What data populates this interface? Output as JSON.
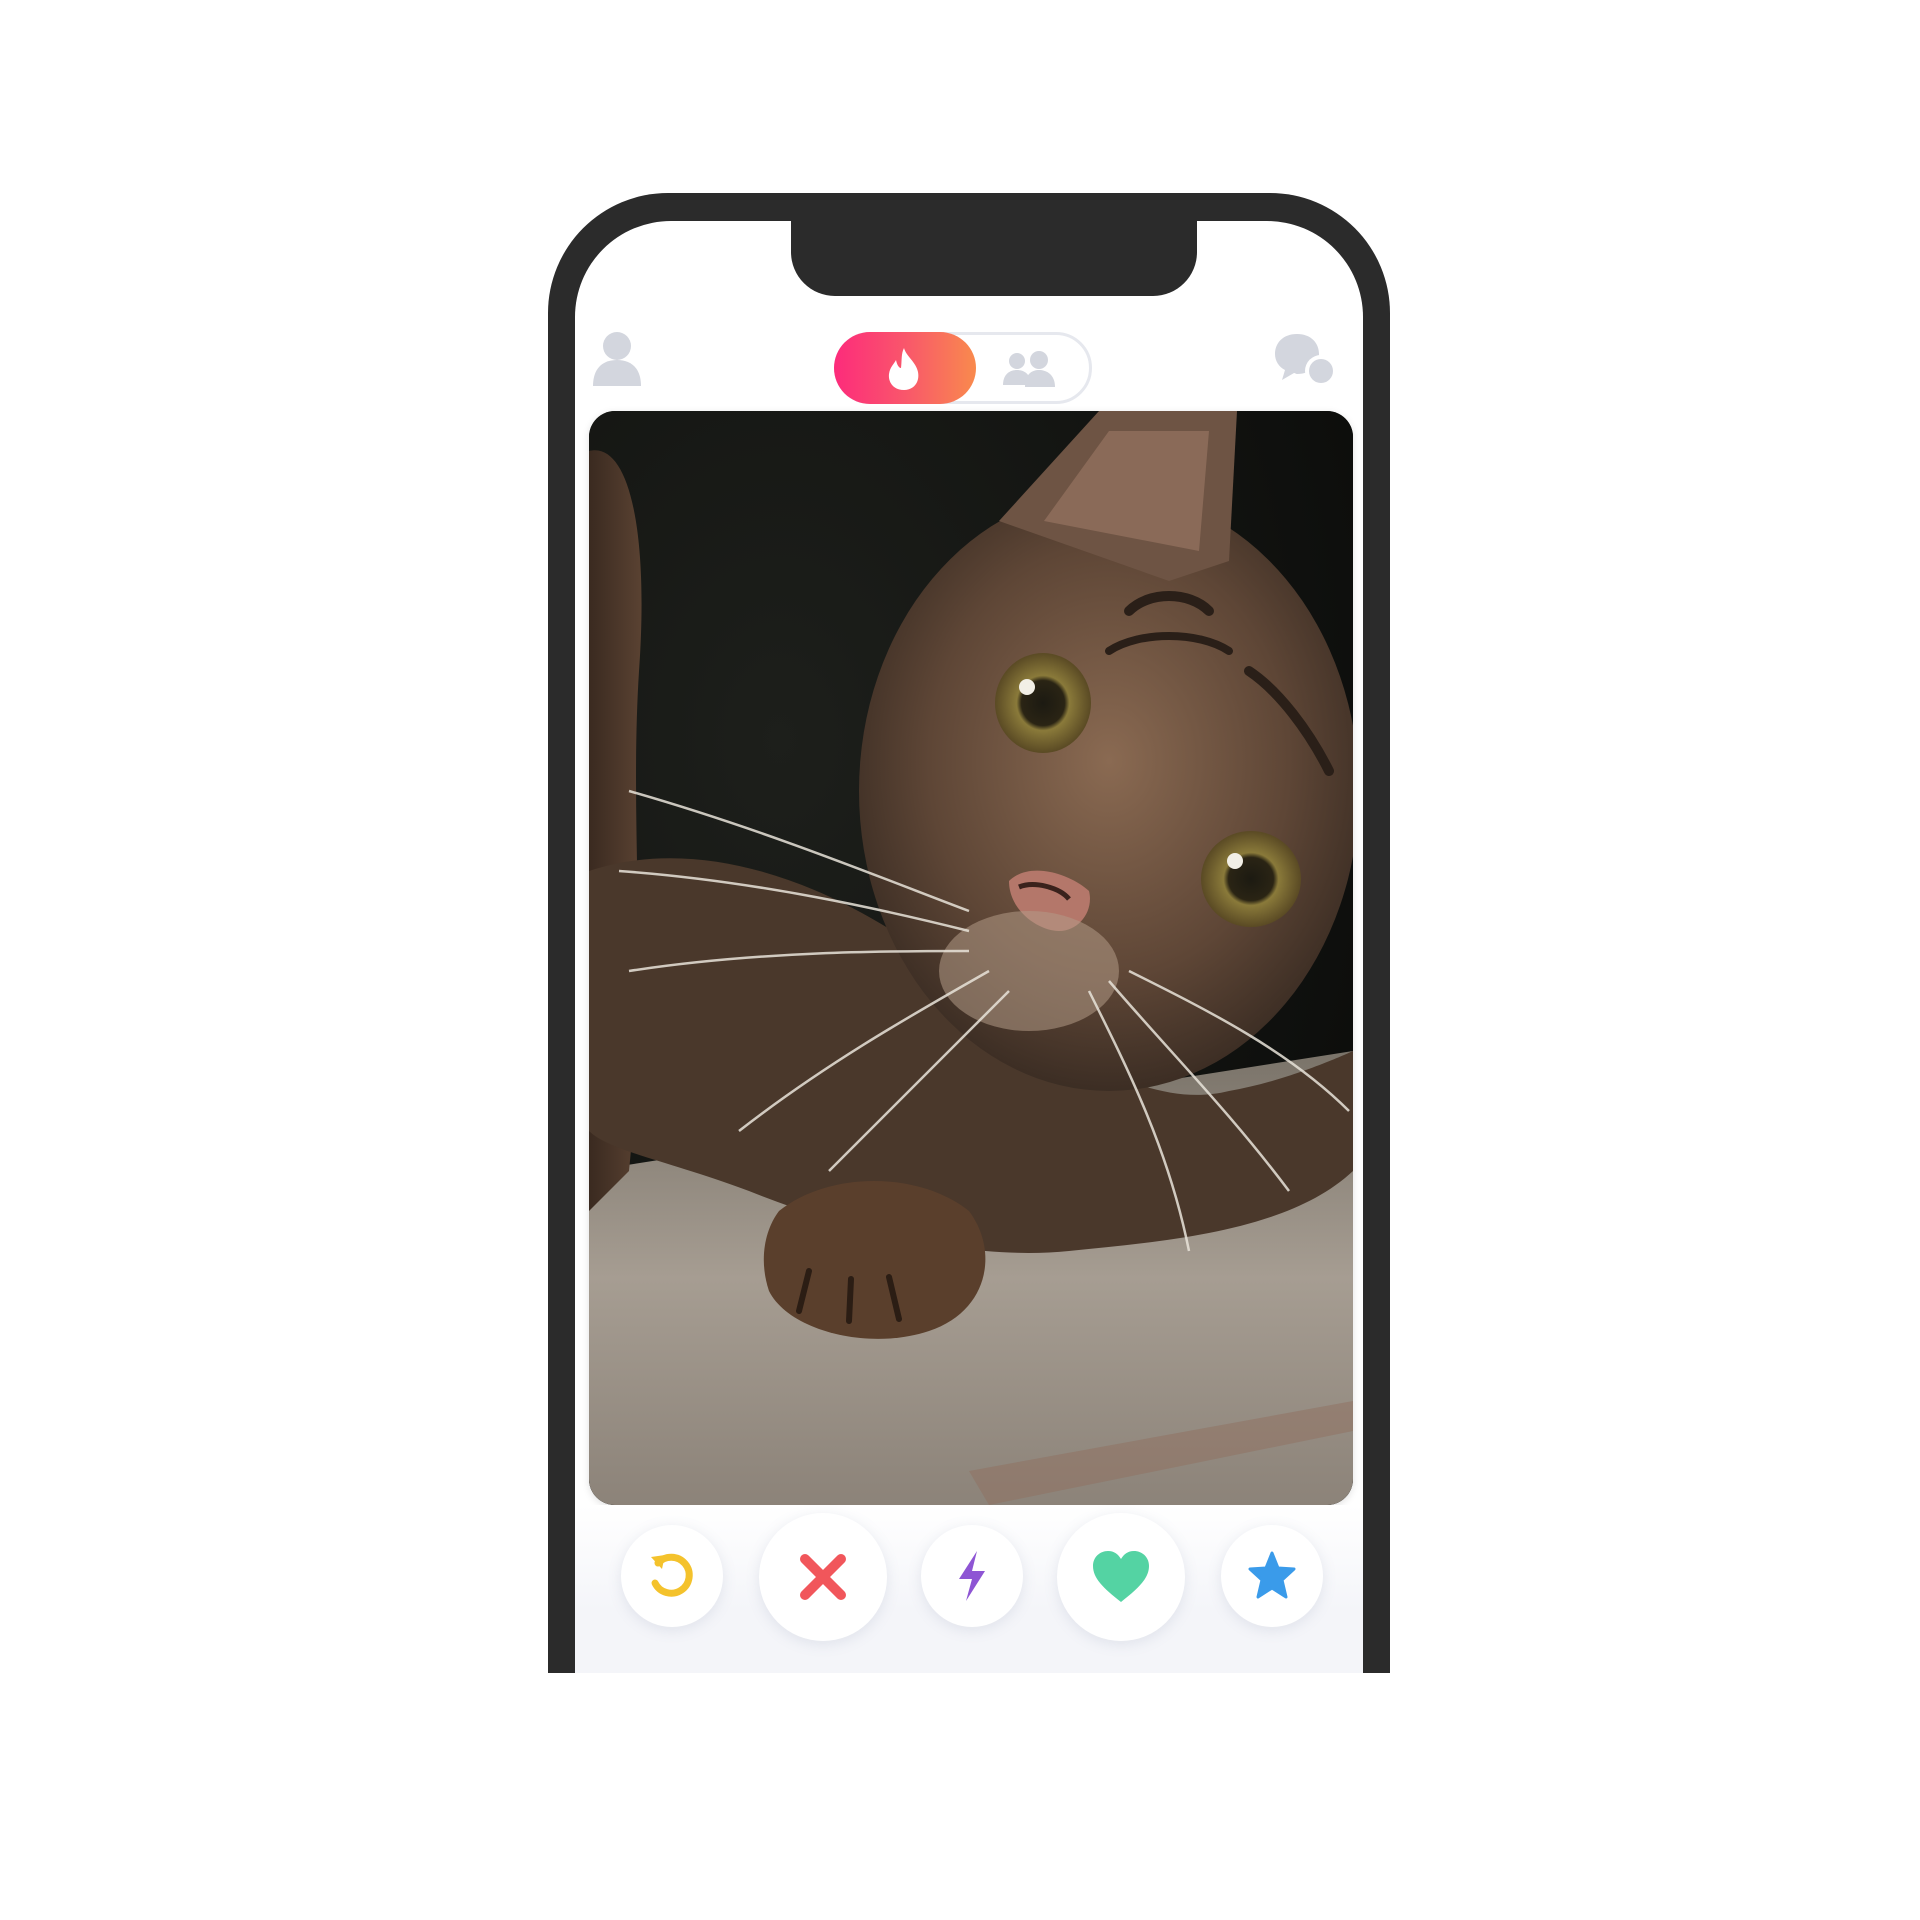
{
  "app": {
    "colors": {
      "brand_gradient": [
        "#fd2b7b",
        "#f98a4d"
      ],
      "inactive_icon": "#d3d6de",
      "rewind": "#f4c22c",
      "nope": "#f1565b",
      "boost": "#8e55d4",
      "like": "#54d3a3",
      "super_like": "#3a9bea"
    },
    "topbar": {
      "profile_icon": "person-icon",
      "mode_toggle": {
        "active": "flame-icon",
        "inactive": "group-icon"
      },
      "messages_icon": "chat-bubbles-icon"
    },
    "card": {
      "photo": "tabby-kitten-photo"
    },
    "actions": [
      {
        "name": "rewind",
        "icon": "rewind-icon"
      },
      {
        "name": "nope",
        "icon": "close-icon"
      },
      {
        "name": "boost",
        "icon": "lightning-icon"
      },
      {
        "name": "like",
        "icon": "heart-icon"
      },
      {
        "name": "super-like",
        "icon": "star-icon"
      }
    ]
  }
}
